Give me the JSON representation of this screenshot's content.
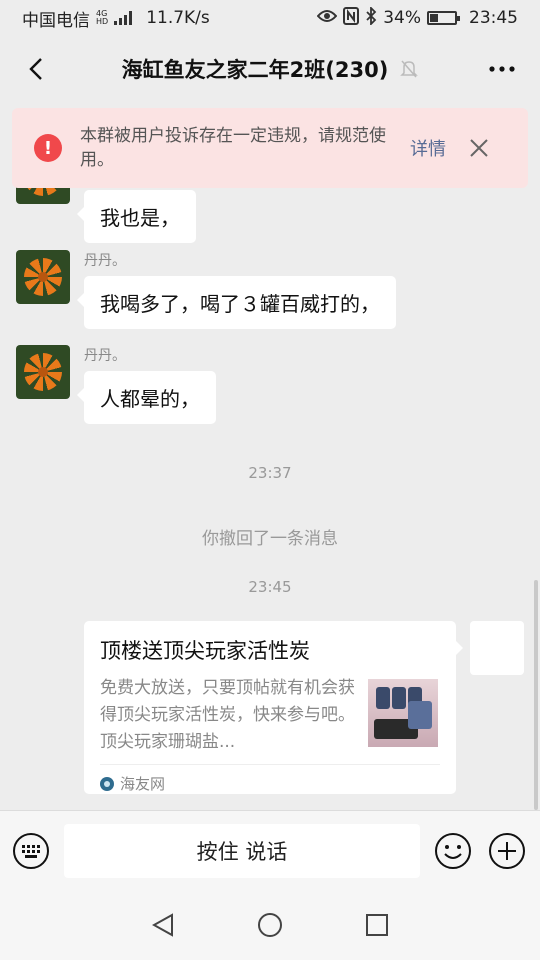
{
  "status_bar": {
    "carrier": "中国电信",
    "network_top": "4G",
    "network_bottom": "HD",
    "speed": "11.7K/s",
    "battery": "34%",
    "battery_level": 0.34,
    "time": "23:45"
  },
  "header": {
    "title": "海缸鱼友之家二年2班(230)"
  },
  "banner": {
    "icon": "!",
    "message": "本群被用户投诉存在一定违规，请规范使用。",
    "detail_label": "详情"
  },
  "messages": [
    {
      "sender": "",
      "text": "我也是，"
    },
    {
      "sender": "丹丹。",
      "text": "我喝多了，喝了３罐百威打的，"
    },
    {
      "sender": "丹丹。",
      "text": "人都晕的，"
    }
  ],
  "timestamps": [
    "23:37",
    "23:45"
  ],
  "recall_notice": "你撤回了一条消息",
  "link_card": {
    "title": "顶楼送顶尖玩家活性炭",
    "description": "免费大放送，只要顶帖就有机会获得顶尖玩家活性炭，快来参与吧。顶尖玩家珊瑚盐...",
    "source": "海友网"
  },
  "input_bar": {
    "hold_to_talk_label": "按住 说话"
  },
  "colors": {
    "background": "#ededed",
    "banner_bg": "#fbe3e3",
    "warning_red": "#f0484b",
    "link_blue": "#576b95"
  }
}
